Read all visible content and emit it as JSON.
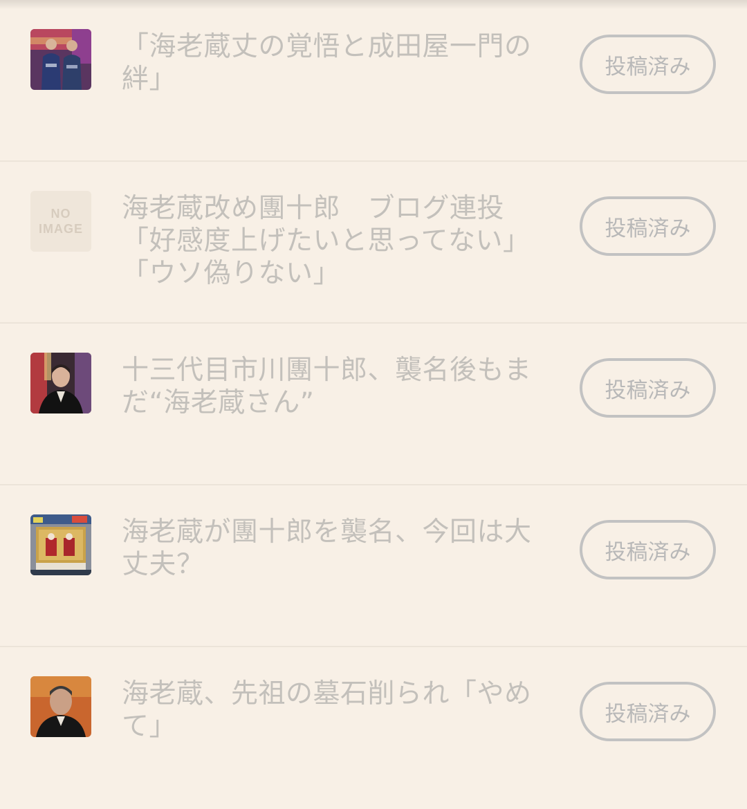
{
  "articles": [
    {
      "title": "「海老蔵丈の覚悟と成田屋一門の絆」",
      "thumbnail": "photo-two-men-kimono",
      "status_label": "投稿済み"
    },
    {
      "title": "海老蔵改め團十郎　ブログ連投「好感度上げたいと思ってない」「ウソ偽りない」",
      "thumbnail": "no-image",
      "thumbnail_text_1": "NO",
      "thumbnail_text_2": "IMAGE",
      "status_label": "投稿済み"
    },
    {
      "title": "十三代目市川團十郎、襲名後もまだ“海老蔵さん”",
      "thumbnail": "photo-man-kimono",
      "status_label": "投稿済み"
    },
    {
      "title": "海老蔵が團十郎を襲名、今回は大丈夫？",
      "thumbnail": "photo-kabuki-billboard",
      "status_label": "投稿済み"
    },
    {
      "title": "海老蔵、先祖の墓石削られ「やめて」",
      "thumbnail": "photo-man-portrait",
      "status_label": "投稿済み"
    }
  ]
}
